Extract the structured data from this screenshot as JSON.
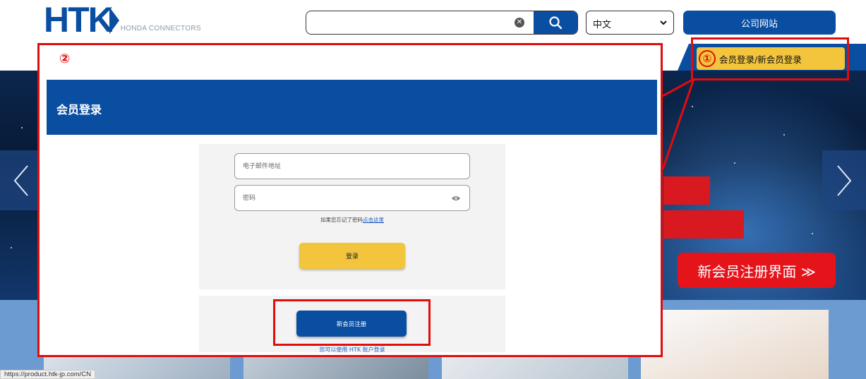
{
  "header": {
    "logo_text": "HTK",
    "logo_subtext": "HONDA CONNECTORS",
    "search_value": "",
    "language_selected": "中文",
    "corporate_button": "公司网站",
    "member_button": "会员登录/新会员登录"
  },
  "hero": {
    "register_banner": "新会员注册界面 ≫"
  },
  "modal": {
    "step_number": "②",
    "title": "会员登录",
    "email_placeholder": "电子邮件地址",
    "password_placeholder": "密码",
    "forgot_text": "如果您忘记了密码",
    "forgot_link": "点击这里",
    "login_button": "登录",
    "new_register_button": "新会员注册",
    "register_note": "您可以使用 HTK 账户登录"
  },
  "annotations": {
    "step_one": "①"
  },
  "status_bar": {
    "url": "https://product.htk-jp.com/CN"
  },
  "colors": {
    "brand_blue": "#0a4ea2",
    "accent_yellow": "#f2c53d",
    "highlight_red": "#e00d0d"
  }
}
